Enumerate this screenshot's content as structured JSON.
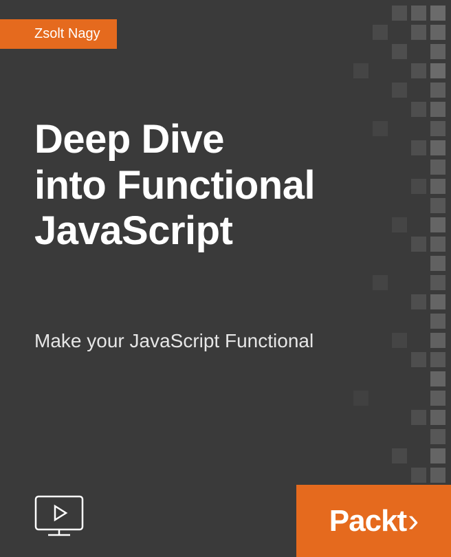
{
  "author": "Zsolt Nagy",
  "title_line1": "Deep Dive",
  "title_line2": "into Functional",
  "title_line3": "JavaScript",
  "subtitle": "Make your JavaScript Functional",
  "brand": "Packt",
  "colors": {
    "background": "#3a3a3a",
    "accent": "#e56a1e",
    "text_primary": "#ffffff",
    "text_secondary": "#e6e6e6"
  },
  "icons": {
    "video": "video-screen-play-icon"
  }
}
